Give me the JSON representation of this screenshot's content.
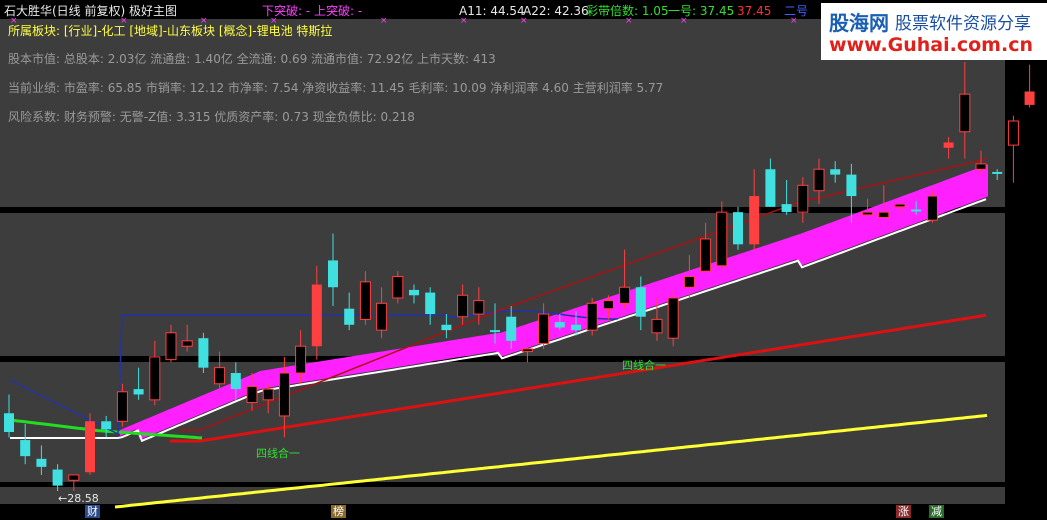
{
  "header": {
    "title": "石大胜华(日线 前复权) 极好主图",
    "down_break": "下突破: -",
    "up_break": "上突破: -",
    "a11": "A11: 44.54",
    "a22": "A22: 42.36",
    "band_multiple": "彩带倍数: 1.05",
    "line1": "一号: 37.45",
    "line1b": "37.45",
    "line2": "二号"
  },
  "sector": "所属板块: [行业]-化工 [地域]-山东板块 [概念]-锂电池 特斯拉",
  "info": {
    "capital": "股本市值: 总股本: 2.03亿 流通盘: 1.40亿 全流通: 0.69 流通市值: 72.92亿 上市天数: 413",
    "performance": "当前业绩: 市盈率: 65.85 市销率: 12.12 市净率: 7.54 净资收益率: 11.45 毛利率: 10.09 净利润率 4.60 主营利润率 5.77",
    "risk": "风险系数: 财务预警: 无警-Z值: 3.315 优质资产率: 0.73 现金负债比: 0.218"
  },
  "logo": {
    "name": "股海网",
    "slogan": "股票软件资源分享",
    "url": "www.Guhai.com.cn"
  },
  "annotations": {
    "low_label": "28.58",
    "four_line_1": "四线合一",
    "four_line_2": "四线合一"
  },
  "bottom_tags": [
    {
      "label": "财",
      "color": "#2a4a8a"
    },
    {
      "label": "榜",
      "color": "#8a6a2a"
    },
    {
      "label": "涨",
      "color": "#8a2a2a"
    },
    {
      "label": "减",
      "color": "#2a6a2a"
    }
  ],
  "colors": {
    "background": "#000000",
    "panel": "#3d3d3d",
    "up_candle": "#ff4040",
    "down_candle": "#40e0e0",
    "band": "#ff20ff",
    "ma_red": "#dd1111",
    "ma_yellow": "#ffff33",
    "ma_darkred": "#aa1111",
    "ma_blue": "#2233aa",
    "ma_green": "#22dd22",
    "ma_white": "#ffffff"
  },
  "chart_data": {
    "type": "candlestick",
    "low_value": 28.58,
    "candles": [
      {
        "o": 31.5,
        "h": 32.2,
        "l": 30.6,
        "c": 30.8,
        "t": "d"
      },
      {
        "o": 30.5,
        "h": 31.1,
        "l": 29.6,
        "c": 29.9,
        "t": "d"
      },
      {
        "o": 29.8,
        "h": 30.3,
        "l": 29.2,
        "c": 29.5,
        "t": "d"
      },
      {
        "o": 29.4,
        "h": 29.6,
        "l": 28.6,
        "c": 28.8,
        "t": "d"
      },
      {
        "o": 29.0,
        "h": 29.2,
        "l": 28.6,
        "c": 29.2,
        "t": "u"
      },
      {
        "o": 29.3,
        "h": 31.5,
        "l": 29.2,
        "c": 31.2,
        "t": "l"
      },
      {
        "o": 30.9,
        "h": 31.4,
        "l": 30.6,
        "c": 31.2,
        "t": "d"
      },
      {
        "o": 31.2,
        "h": 32.6,
        "l": 31.0,
        "c": 32.3,
        "t": "u"
      },
      {
        "o": 32.4,
        "h": 33.2,
        "l": 32.0,
        "c": 32.2,
        "t": "d"
      },
      {
        "o": 32.0,
        "h": 34.2,
        "l": 31.8,
        "c": 33.6,
        "t": "u"
      },
      {
        "o": 33.5,
        "h": 34.8,
        "l": 33.4,
        "c": 34.5,
        "t": "u"
      },
      {
        "o": 34.2,
        "h": 34.8,
        "l": 33.8,
        "c": 34.0,
        "t": "u"
      },
      {
        "o": 34.3,
        "h": 34.5,
        "l": 33.0,
        "c": 33.2,
        "t": "d"
      },
      {
        "o": 33.2,
        "h": 33.8,
        "l": 32.2,
        "c": 32.6,
        "t": "u"
      },
      {
        "o": 33.0,
        "h": 33.4,
        "l": 32.0,
        "c": 32.4,
        "t": "d"
      },
      {
        "o": 32.5,
        "h": 33.0,
        "l": 31.6,
        "c": 31.9,
        "t": "u"
      },
      {
        "o": 32.0,
        "h": 32.6,
        "l": 31.5,
        "c": 32.4,
        "t": "u"
      },
      {
        "o": 31.4,
        "h": 33.6,
        "l": 30.6,
        "c": 33.0,
        "t": "u"
      },
      {
        "o": 33.0,
        "h": 34.6,
        "l": 32.6,
        "c": 34.0,
        "t": "u"
      },
      {
        "o": 34.0,
        "h": 37.0,
        "l": 33.5,
        "c": 36.3,
        "t": "l"
      },
      {
        "o": 36.2,
        "h": 38.2,
        "l": 35.5,
        "c": 37.2,
        "t": "d"
      },
      {
        "o": 35.4,
        "h": 36.0,
        "l": 34.6,
        "c": 34.8,
        "t": "d"
      },
      {
        "o": 35.0,
        "h": 36.8,
        "l": 34.8,
        "c": 36.4,
        "t": "u"
      },
      {
        "o": 34.6,
        "h": 36.2,
        "l": 34.3,
        "c": 35.6,
        "t": "u"
      },
      {
        "o": 35.8,
        "h": 36.8,
        "l": 35.6,
        "c": 36.6,
        "t": "u"
      },
      {
        "o": 36.1,
        "h": 36.3,
        "l": 35.6,
        "c": 35.9,
        "t": "d"
      },
      {
        "o": 36.0,
        "h": 36.2,
        "l": 34.8,
        "c": 35.2,
        "t": "d"
      },
      {
        "o": 34.8,
        "h": 35.2,
        "l": 34.3,
        "c": 34.6,
        "t": "d"
      },
      {
        "o": 35.1,
        "h": 36.3,
        "l": 34.8,
        "c": 35.9,
        "t": "u"
      },
      {
        "o": 35.2,
        "h": 36.2,
        "l": 34.8,
        "c": 35.7,
        "t": "u"
      },
      {
        "o": 34.6,
        "h": 35.6,
        "l": 34.1,
        "c": 34.6,
        "t": "d"
      },
      {
        "o": 35.1,
        "h": 35.5,
        "l": 33.9,
        "c": 34.2,
        "t": "d"
      },
      {
        "o": 33.9,
        "h": 34.5,
        "l": 33.4,
        "c": 33.8,
        "t": "u"
      },
      {
        "o": 34.1,
        "h": 35.6,
        "l": 33.9,
        "c": 35.2,
        "t": "u"
      },
      {
        "o": 34.9,
        "h": 35.2,
        "l": 34.6,
        "c": 34.7,
        "t": "d"
      },
      {
        "o": 34.6,
        "h": 35.3,
        "l": 34.4,
        "c": 34.8,
        "t": "d"
      },
      {
        "o": 34.6,
        "h": 35.8,
        "l": 34.4,
        "c": 35.6,
        "t": "u"
      },
      {
        "o": 35.4,
        "h": 35.9,
        "l": 35.0,
        "c": 35.7,
        "t": "u"
      },
      {
        "o": 35.6,
        "h": 37.6,
        "l": 35.4,
        "c": 36.2,
        "t": "u"
      },
      {
        "o": 36.2,
        "h": 36.6,
        "l": 34.6,
        "c": 35.1,
        "t": "d"
      },
      {
        "o": 35.0,
        "h": 35.8,
        "l": 34.2,
        "c": 34.5,
        "t": "u"
      },
      {
        "o": 34.3,
        "h": 36.1,
        "l": 34.0,
        "c": 35.8,
        "t": "u"
      },
      {
        "o": 36.2,
        "h": 37.4,
        "l": 35.8,
        "c": 36.6,
        "t": "u"
      },
      {
        "o": 36.8,
        "h": 38.6,
        "l": 36.6,
        "c": 38.0,
        "t": "u"
      },
      {
        "o": 37.0,
        "h": 39.4,
        "l": 36.8,
        "c": 39.0,
        "t": "u"
      },
      {
        "o": 39.0,
        "h": 39.2,
        "l": 37.6,
        "c": 37.8,
        "t": "d"
      },
      {
        "o": 37.8,
        "h": 40.6,
        "l": 37.6,
        "c": 39.6,
        "t": "l"
      },
      {
        "o": 40.6,
        "h": 41.0,
        "l": 39.2,
        "c": 39.2,
        "t": "d"
      },
      {
        "o": 39.3,
        "h": 40.2,
        "l": 38.9,
        "c": 39.0,
        "t": "d"
      },
      {
        "o": 39.0,
        "h": 40.3,
        "l": 38.6,
        "c": 40.0,
        "t": "u"
      },
      {
        "o": 39.8,
        "h": 41.0,
        "l": 39.3,
        "c": 40.6,
        "t": "u"
      },
      {
        "o": 40.4,
        "h": 40.9,
        "l": 40.1,
        "c": 40.6,
        "t": "d"
      },
      {
        "o": 40.4,
        "h": 40.8,
        "l": 38.6,
        "c": 39.6,
        "t": "d"
      },
      {
        "o": 38.9,
        "h": 39.5,
        "l": 38.8,
        "c": 39.0,
        "t": "u"
      },
      {
        "o": 38.8,
        "h": 40.0,
        "l": 38.8,
        "c": 39.0,
        "t": "u"
      },
      {
        "o": 39.2,
        "h": 39.3,
        "l": 39.0,
        "c": 39.3,
        "t": "u"
      },
      {
        "o": 39.1,
        "h": 39.4,
        "l": 38.9,
        "c": 39.1,
        "t": "d"
      },
      {
        "o": 38.7,
        "h": 39.8,
        "l": 38.6,
        "c": 39.6,
        "t": "u"
      },
      {
        "o": 41.6,
        "h": 41.8,
        "l": 41.0,
        "c": 41.4,
        "t": "l"
      },
      {
        "o": 42.0,
        "h": 44.6,
        "l": 41.0,
        "c": 43.4,
        "t": "u"
      },
      {
        "o": 40.8,
        "h": 41.3,
        "l": 40.4,
        "c": 40.6,
        "t": "u"
      },
      {
        "o": 40.5,
        "h": 40.6,
        "l": 40.2,
        "c": 40.5,
        "t": "d"
      },
      {
        "o": 41.5,
        "h": 42.6,
        "l": 40.1,
        "c": 42.4,
        "t": "u"
      },
      {
        "o": 43.0,
        "h": 44.5,
        "l": 42.9,
        "c": 43.5,
        "t": "l"
      }
    ]
  }
}
